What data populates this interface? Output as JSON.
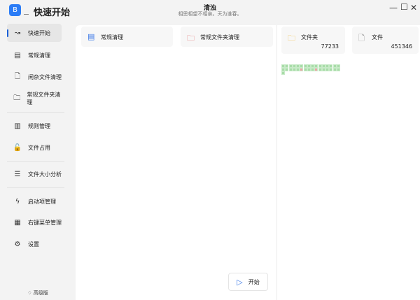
{
  "app": {
    "logo": "B",
    "title": "快速开始",
    "center_title": "清浊",
    "center_subtitle": "相思相望不相亲。天为谁春。"
  },
  "window": {
    "min": "—",
    "max": "☐",
    "close": "✕"
  },
  "sidebar": {
    "items": [
      {
        "label": "快速开始",
        "icon": "speedometer-icon",
        "glyph": "↝",
        "selected": true
      },
      {
        "label": "常规清理",
        "icon": "list-box-icon",
        "glyph": "▤"
      },
      {
        "label": "闲杂文件清理",
        "icon": "file-icon",
        "glyph": "🗋"
      },
      {
        "label": "常规文件夹清理",
        "icon": "folder-icon",
        "glyph": "🗀"
      },
      {
        "label": "规则管理",
        "icon": "rules-icon",
        "glyph": "▥"
      },
      {
        "label": "文件占用",
        "icon": "lock-icon",
        "glyph": "🔓"
      },
      {
        "label": "文件大小分析",
        "icon": "list-icon",
        "glyph": "☰"
      },
      {
        "label": "启动项管理",
        "icon": "lightning-icon",
        "glyph": "ϟ"
      },
      {
        "label": "右键菜单管理",
        "icon": "menu-grid-icon",
        "glyph": "▦"
      },
      {
        "label": "设置",
        "icon": "gear-icon",
        "glyph": "⚙"
      }
    ],
    "pro_label": "高级版"
  },
  "cards": {
    "regular": "常规清理",
    "folder_clean": "常规文件夹清理",
    "folders_label": "文件夹",
    "folders_count": "77233",
    "files_label": "文件",
    "files_count": "451346"
  },
  "grid": {
    "cells": 33,
    "bad_indices": [
      21,
      25
    ]
  },
  "start_label": "开始",
  "colors": {
    "accent": "#2b7cf6",
    "ok": "#a8dca8",
    "bad": "#f0a0a8"
  }
}
